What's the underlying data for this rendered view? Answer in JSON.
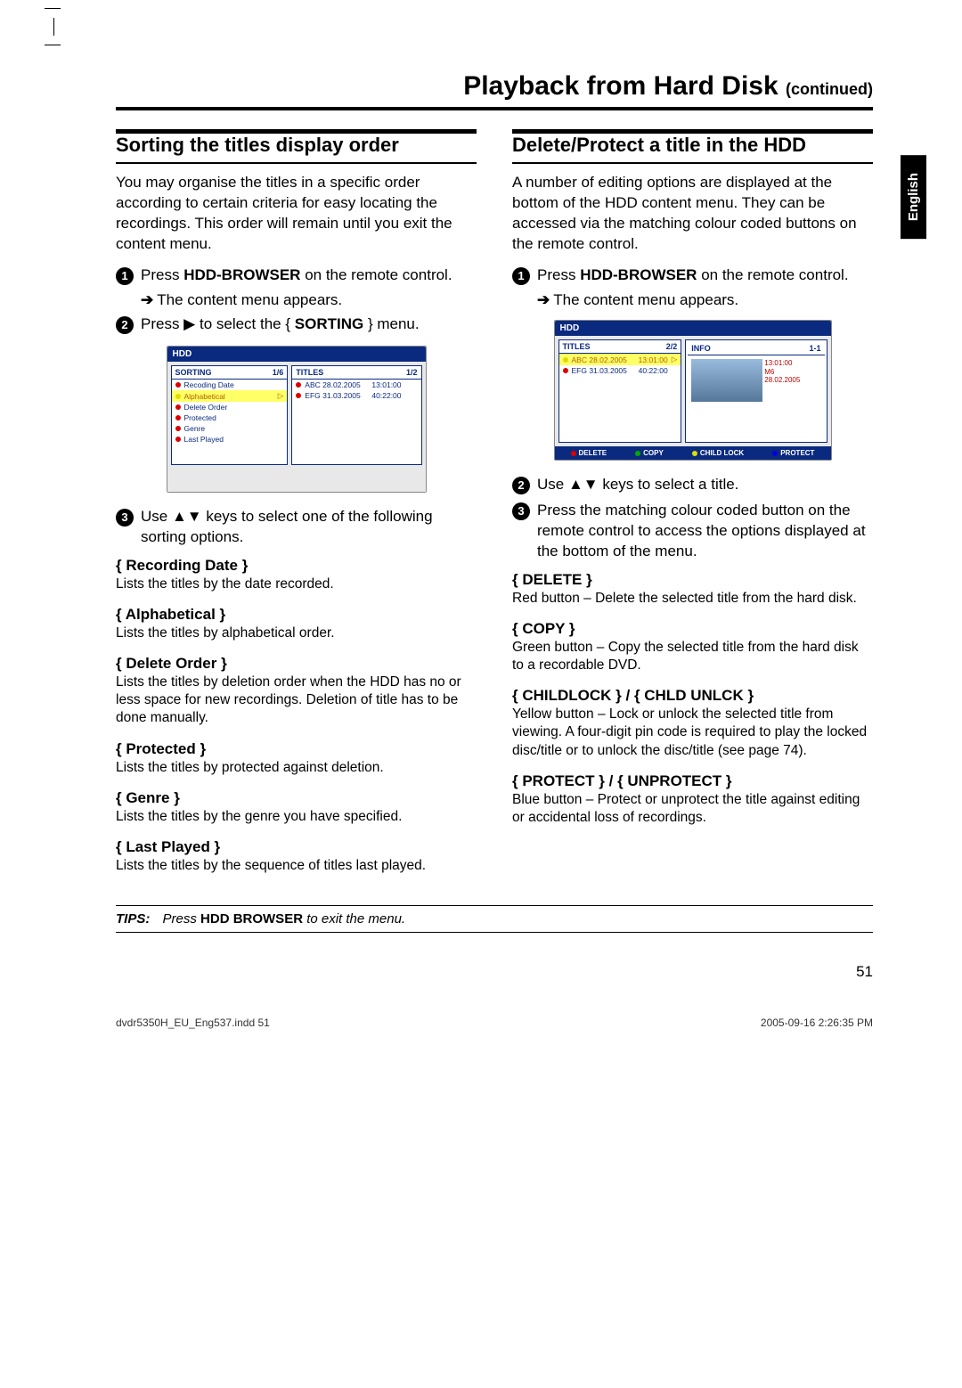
{
  "page": {
    "title_main": "Playback from Hard Disk",
    "title_cont": "(continued)",
    "lang_tab": "English",
    "page_number": "51",
    "footer_left": "dvdr5350H_EU_Eng537.indd   51",
    "footer_right": "2005-09-16   2:26:35 PM",
    "tips_label": "TIPS:",
    "tips_pre": "Press ",
    "tips_bold": "HDD BROWSER",
    "tips_post": " to exit the menu."
  },
  "left": {
    "heading": "Sorting the titles display order",
    "intro": "You may organise the titles in a specific order according to certain criteria for easy locating the recordings. This order will remain until you exit the content menu.",
    "step1_a": "Press ",
    "step1_b": "HDD-BROWSER",
    "step1_c": " on the remote control.",
    "result1": "The content menu appears.",
    "step2_a": "Press ▶ to select the { ",
    "step2_b": "SORTING",
    "step2_c": " } menu.",
    "step3": "Use ▲▼ keys to select one of the following sorting options.",
    "options": [
      {
        "title": "{ Recording Date }",
        "desc": "Lists the titles by the date recorded."
      },
      {
        "title": "{ Alphabetical }",
        "desc": "Lists the titles by alphabetical order."
      },
      {
        "title": "{ Delete Order }",
        "desc": "Lists the titles by deletion order when the HDD has no or less space for new recordings. Deletion of title has to be done manually."
      },
      {
        "title": "{ Protected }",
        "desc": "Lists the titles by protected against deletion."
      },
      {
        "title": "{ Genre }",
        "desc": "Lists the titles by the genre you have specified."
      },
      {
        "title": "{ Last Played }",
        "desc": "Lists the titles by the sequence of titles last played."
      }
    ],
    "osd": {
      "hdd": "HDD",
      "sort_label": "SORTING",
      "sort_page": "1/6",
      "titles_label": "TITLES",
      "titles_page": "1/2",
      "sort_items": [
        "Recoding Date",
        "Alphabetical",
        "Delete Order",
        "Protected",
        "Genre",
        "Last Played"
      ],
      "title_items": [
        {
          "n": "ABC 28.02.2005",
          "t": "13:01:00"
        },
        {
          "n": "EFG 31.03.2005",
          "t": "40:22:00"
        }
      ]
    }
  },
  "right": {
    "heading": "Delete/Protect a title in the HDD",
    "intro": "A number of editing options are displayed at the bottom of the HDD content menu. They can be accessed via the matching colour coded buttons on the remote control.",
    "step1_a": "Press ",
    "step1_b": "HDD-BROWSER",
    "step1_c": " on the remote control.",
    "result1": "The content menu appears.",
    "step2": "Use ▲▼ keys to select a title.",
    "step3": "Press the matching colour coded button on the remote control to access the options displayed at the bottom of the menu.",
    "options": [
      {
        "title": "{ DELETE }",
        "desc": "Red button – Delete the selected title from the hard disk."
      },
      {
        "title": "{ COPY }",
        "desc": "Green button – Copy the selected title from the hard disk to a recordable DVD."
      },
      {
        "title": "{ CHILDLOCK } / { CHLD UNLCK }",
        "desc": "Yellow button – Lock or unlock the selected title from viewing.  A four-digit pin code is required to play the locked disc/title or to unlock the disc/title (see page 74)."
      },
      {
        "title": "{ PROTECT } / { UNPROTECT }",
        "desc": "Blue button – Protect or unprotect the title against editing or accidental loss of recordings."
      }
    ],
    "osd": {
      "hdd": "HDD",
      "titles_label": "TITLES",
      "titles_page": "2/2",
      "info_label": "INFO",
      "info_page": "1-1",
      "title_items": [
        {
          "n": "ABC 28.02.2005",
          "t": "13:01:00"
        },
        {
          "n": "EFG 31.03.2005",
          "t": "40:22:00"
        }
      ],
      "info_time": "13:01:00",
      "info_mk": "M6",
      "info_date": "28.02.2005",
      "actions": [
        "DELETE",
        "COPY",
        "CHILD LOCK",
        "PROTECT"
      ]
    }
  }
}
